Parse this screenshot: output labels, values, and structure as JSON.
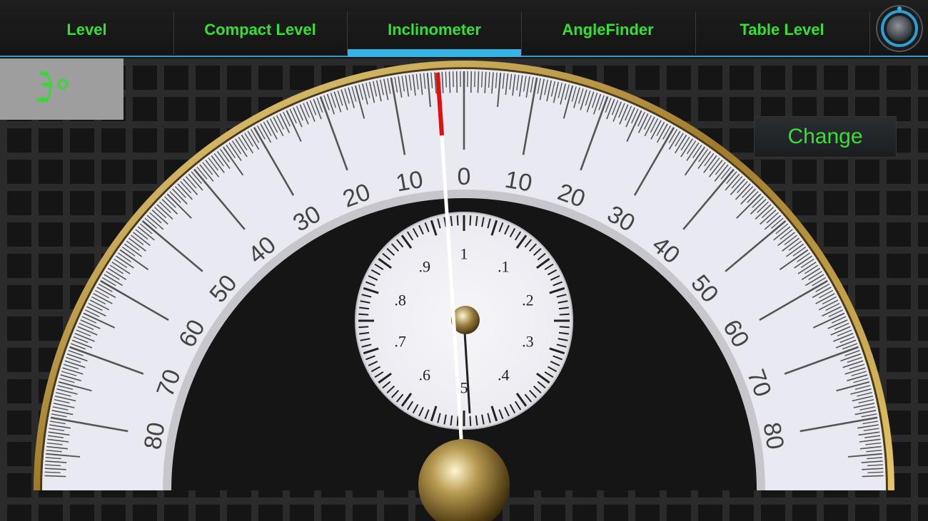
{
  "tabs": [
    {
      "label": "Level"
    },
    {
      "label": "Compact Level"
    },
    {
      "label": "Inclinometer"
    },
    {
      "label": "AngleFinder"
    },
    {
      "label": "Table Level"
    }
  ],
  "active_tab": "Inclinometer",
  "change_button": {
    "label": "Change"
  },
  "protractor": {
    "left_labels": [
      "10",
      "20",
      "30",
      "40",
      "50",
      "60",
      "70",
      "80"
    ],
    "center_label": "0",
    "right_labels": [
      "10",
      "20",
      "30",
      "40",
      "50",
      "60",
      "70",
      "80"
    ],
    "needle_angle_deg": 2.2
  },
  "small_dial": {
    "labels": [
      "1",
      ".1",
      ".2",
      ".3",
      ".4",
      "5",
      ".6",
      ".7",
      ".8",
      ".9"
    ]
  },
  "colors": {
    "tab_text": "#35e034",
    "accent_blue": "#35b5e5",
    "button_text": "#39e034",
    "needle_red": "#e01010"
  },
  "icons": {
    "logo": "green-leaf-logo-icon",
    "knob": "settings-knob-icon"
  }
}
